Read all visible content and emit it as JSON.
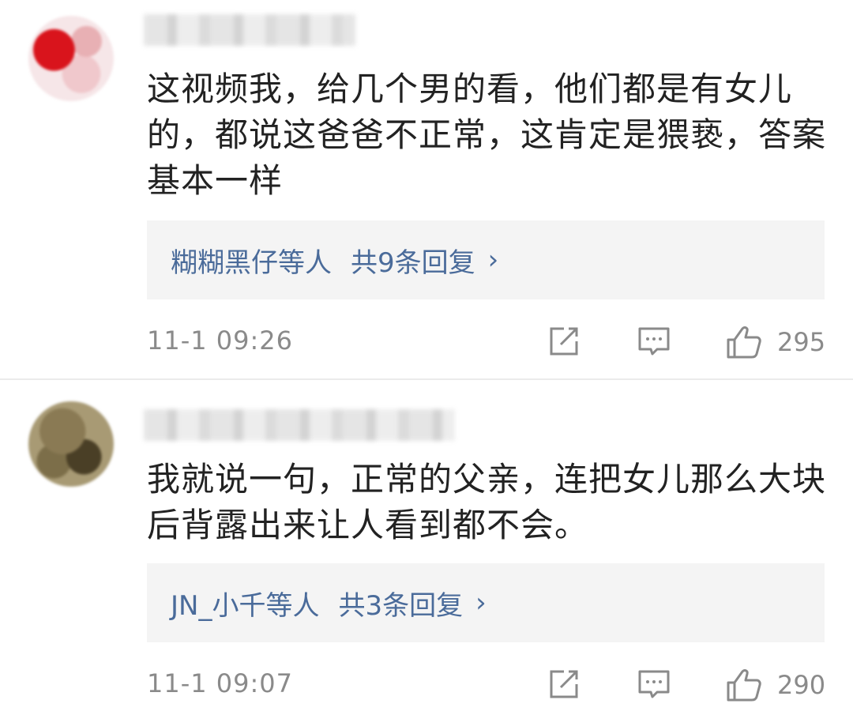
{
  "comments": [
    {
      "text": "这视频我，给几个男的看，他们都是有女儿的，都说这爸爸不正常，这肯定是猥亵，答案基本一样",
      "reply_names": "糊糊黑仔等人",
      "reply_count": "共9条回复",
      "reply_chevron": "›",
      "timestamp": "11-1 09:26",
      "likes": "295",
      "avatar_color": "#d9141c"
    },
    {
      "text": "我就说一句，正常的父亲，连把女儿那么大块后背露出来让人看到都不会。",
      "reply_names": "JN_小千等人",
      "reply_count": "共3条回复",
      "reply_chevron": "›",
      "timestamp": "11-1 09:07",
      "likes": "290",
      "avatar_color": "#8a7a54"
    }
  ],
  "icons": {
    "share": "share-icon",
    "comment": "comment-icon",
    "like": "like-icon"
  },
  "colors": {
    "text": "#222222",
    "link": "#4a6b9a",
    "meta": "#8a8a8a",
    "reply_bg": "#f4f4f4"
  }
}
